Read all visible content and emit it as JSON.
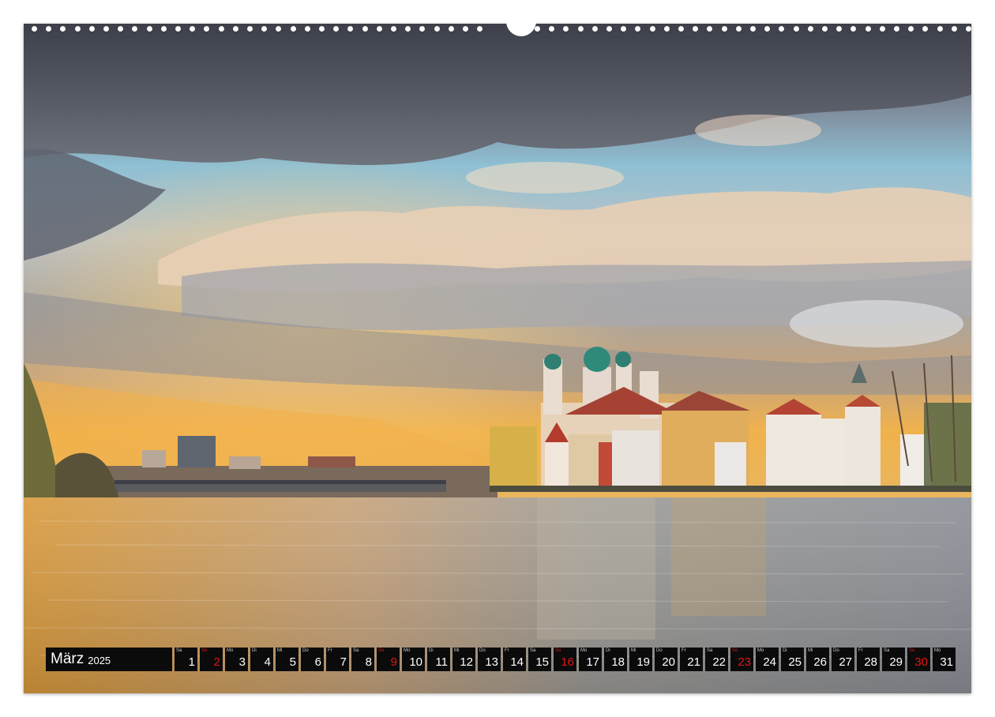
{
  "calendar": {
    "month": "März",
    "year": "2025",
    "days": [
      {
        "wd": "Sa",
        "d": "1"
      },
      {
        "wd": "So",
        "d": "2"
      },
      {
        "wd": "Mo",
        "d": "3"
      },
      {
        "wd": "Di",
        "d": "4"
      },
      {
        "wd": "Mi",
        "d": "5"
      },
      {
        "wd": "Do",
        "d": "6"
      },
      {
        "wd": "Fr",
        "d": "7"
      },
      {
        "wd": "Sa",
        "d": "8"
      },
      {
        "wd": "So",
        "d": "9"
      },
      {
        "wd": "Mo",
        "d": "10"
      },
      {
        "wd": "Di",
        "d": "11"
      },
      {
        "wd": "Mi",
        "d": "12"
      },
      {
        "wd": "Do",
        "d": "13"
      },
      {
        "wd": "Fr",
        "d": "14"
      },
      {
        "wd": "Sa",
        "d": "15"
      },
      {
        "wd": "So",
        "d": "16"
      },
      {
        "wd": "Mo",
        "d": "17"
      },
      {
        "wd": "Di",
        "d": "18"
      },
      {
        "wd": "Mi",
        "d": "19"
      },
      {
        "wd": "Do",
        "d": "20"
      },
      {
        "wd": "Fr",
        "d": "21"
      },
      {
        "wd": "Sa",
        "d": "22"
      },
      {
        "wd": "So",
        "d": "23"
      },
      {
        "wd": "Mo",
        "d": "24"
      },
      {
        "wd": "Di",
        "d": "25"
      },
      {
        "wd": "Mi",
        "d": "26"
      },
      {
        "wd": "Do",
        "d": "27"
      },
      {
        "wd": "Fr",
        "d": "28"
      },
      {
        "wd": "Sa",
        "d": "29"
      },
      {
        "wd": "So",
        "d": "30"
      },
      {
        "wd": "Mo",
        "d": "31"
      }
    ],
    "sunday_color": "#e01818"
  }
}
